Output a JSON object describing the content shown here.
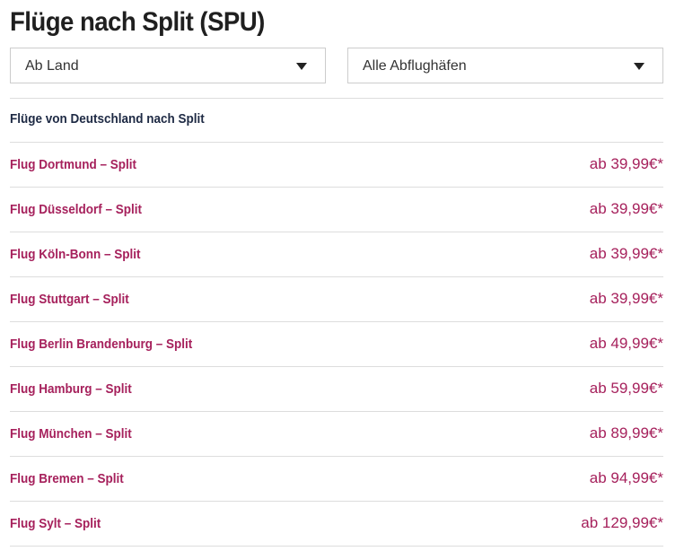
{
  "page": {
    "title": "Flüge nach Split (SPU)"
  },
  "filters": {
    "country": {
      "selected": "Ab Land",
      "icon": "chevron-down-icon"
    },
    "airport": {
      "selected": "Alle Abflughäfen",
      "icon": "chevron-down-icon"
    }
  },
  "section": {
    "heading": "Flüge von Deutschland nach Split"
  },
  "flights": [
    {
      "route": "Flug Dortmund – Split",
      "price": "ab 39,99€*"
    },
    {
      "route": "Flug Düsseldorf – Split",
      "price": "ab 39,99€*"
    },
    {
      "route": "Flug Köln-Bonn – Split",
      "price": "ab 39,99€*"
    },
    {
      "route": "Flug Stuttgart – Split",
      "price": "ab 39,99€*"
    },
    {
      "route": "Flug Berlin Brandenburg – Split",
      "price": "ab 49,99€*"
    },
    {
      "route": "Flug Hamburg – Split",
      "price": "ab 59,99€*"
    },
    {
      "route": "Flug München – Split",
      "price": "ab 89,99€*"
    },
    {
      "route": "Flug Bremen – Split",
      "price": "ab 94,99€*"
    },
    {
      "route": "Flug Sylt – Split",
      "price": "ab 129,99€*"
    }
  ],
  "colors": {
    "accent": "#a6215c",
    "heading": "#1e2a44",
    "title": "#1f1f1f",
    "divider": "#dddddd"
  }
}
